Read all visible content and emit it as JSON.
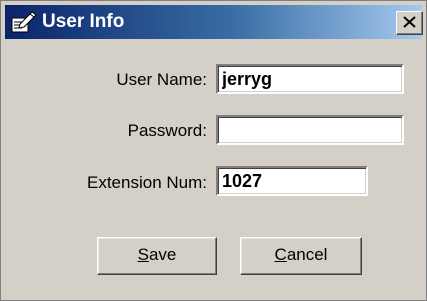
{
  "window": {
    "title": "User Info",
    "icon": "notepad-pen-icon",
    "close_icon": "close-x-icon"
  },
  "form": {
    "username": {
      "label": "User Name:",
      "value": "jerryg"
    },
    "password": {
      "label": "Password:",
      "value": ""
    },
    "extension": {
      "label": "Extension Num:",
      "value": "1027"
    }
  },
  "buttons": {
    "save": {
      "mnemonic": "S",
      "rest": "ave"
    },
    "cancel": {
      "mnemonic": "C",
      "rest": "ancel"
    }
  },
  "colors": {
    "titlebar_start": "#0a246a",
    "titlebar_end": "#a6caf0",
    "dialog_bg": "#d4d0c8"
  }
}
